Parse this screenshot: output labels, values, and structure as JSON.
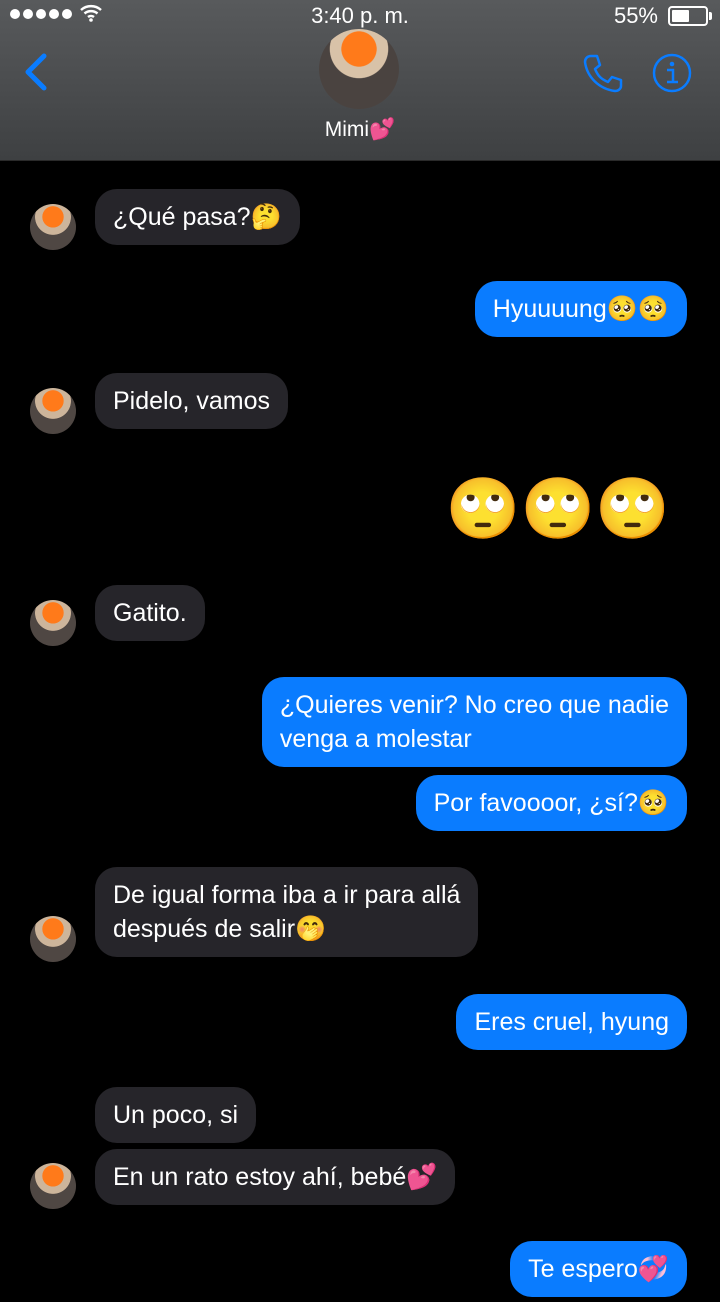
{
  "status": {
    "time": "3:40 p. m.",
    "battery": "55%",
    "battery_level": 0.55
  },
  "header": {
    "contact_name": "Mimi💕"
  },
  "messages": [
    {
      "side": "in",
      "text": "¿Qué pasa?🤔"
    },
    {
      "side": "out",
      "text": "Hyuuuung🥺🥺"
    },
    {
      "side": "in",
      "text": "Pidelo, vamos"
    },
    {
      "side": "out",
      "text": "🙄🙄🙄"
    },
    {
      "side": "in",
      "text": "Gatito."
    },
    {
      "side": "out",
      "line1": "¿Quieres venir? No creo que nadie",
      "line2": "venga a molestar"
    },
    {
      "side": "out",
      "text": "Por favoooor, ¿sí?🥺"
    },
    {
      "side": "in",
      "line1": "De igual forma iba a ir para allá",
      "line2": "después de salir🤭"
    },
    {
      "side": "out",
      "text": "Eres cruel, hyung"
    },
    {
      "side": "in",
      "text": "Un poco, si"
    },
    {
      "side": "in",
      "text": "En un rato estoy ahí, bebé💕"
    },
    {
      "side": "out",
      "text": "Te espero💞"
    }
  ],
  "colors": {
    "incoming": "#26252a",
    "outgoing": "#0a7cff",
    "accent": "#0a7cff"
  },
  "icons": [
    "back-chevron-icon",
    "phone-icon",
    "info-icon",
    "wifi-icon",
    "battery-icon"
  ]
}
